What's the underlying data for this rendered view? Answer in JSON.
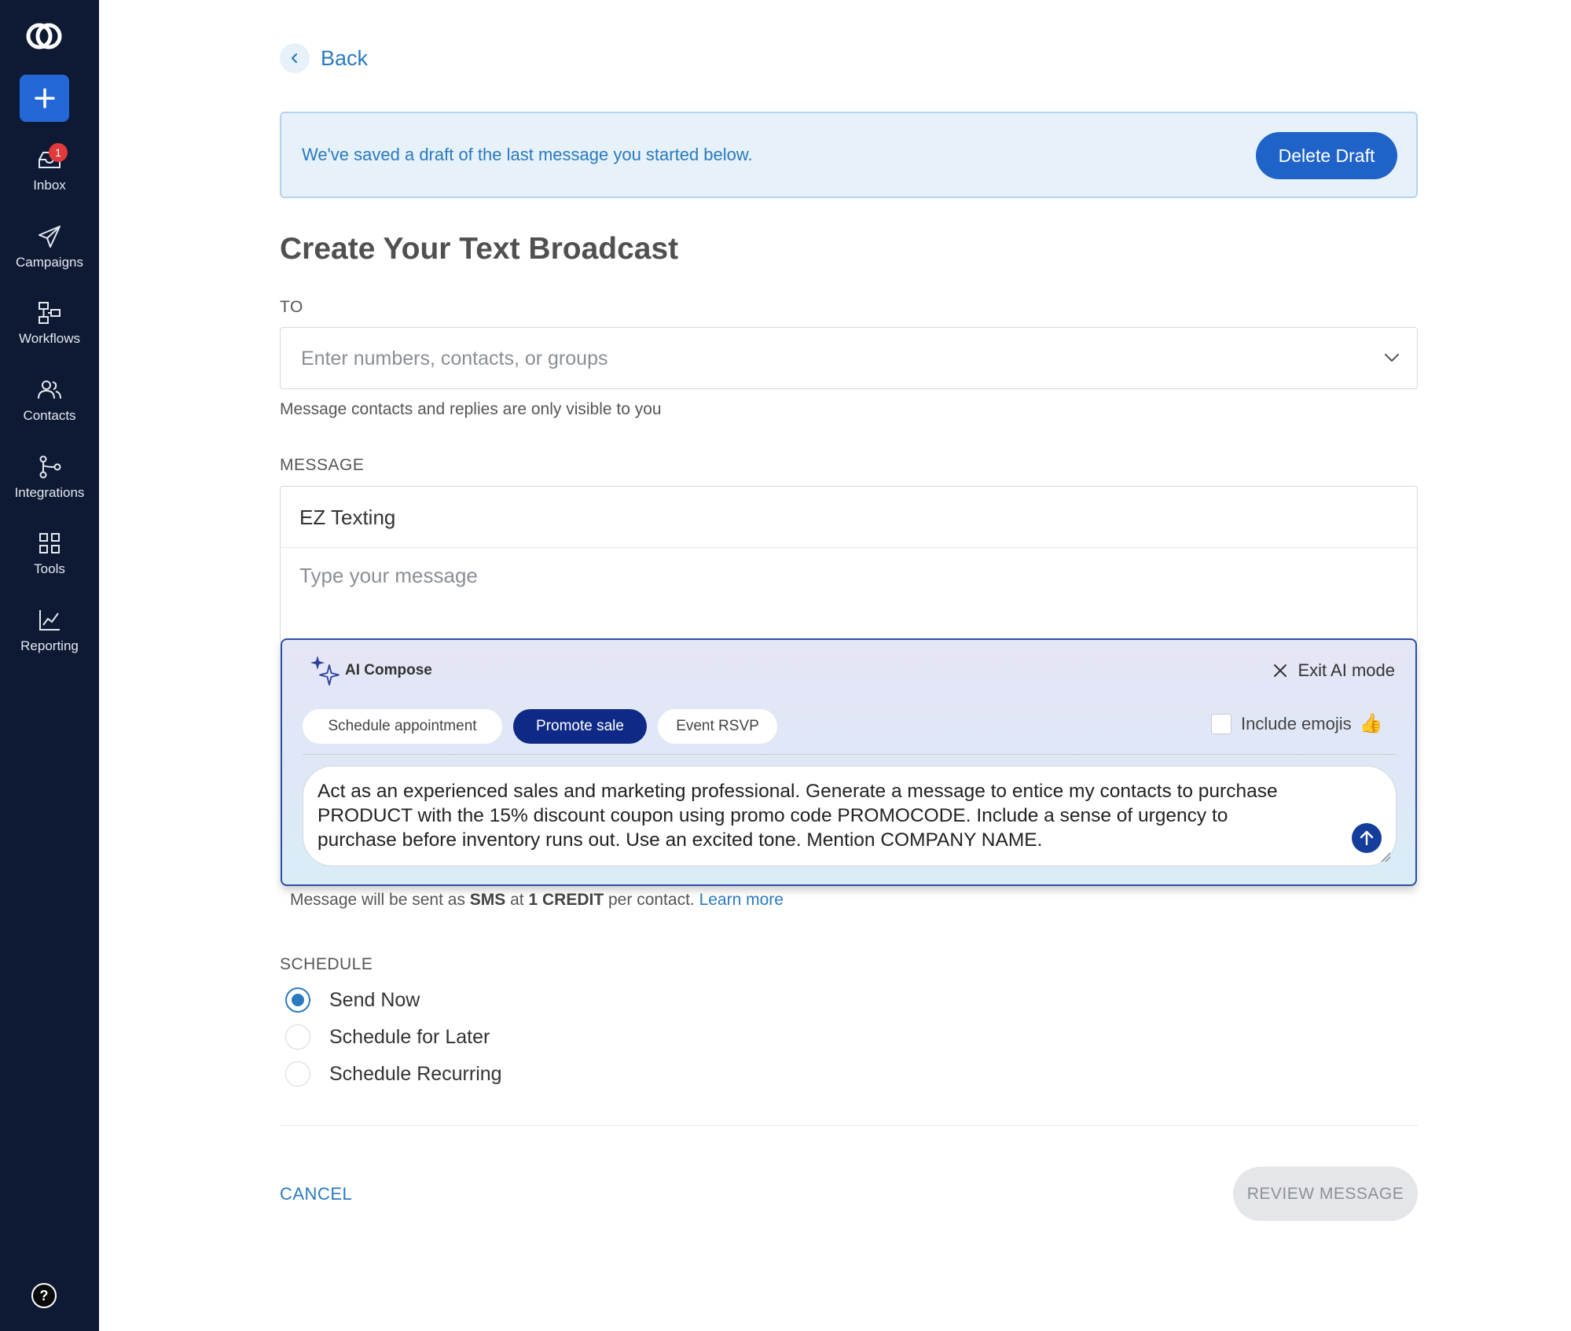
{
  "sidebar": {
    "inbox_badge": "1",
    "items": [
      {
        "label": "Inbox",
        "icon": "inbox-icon"
      },
      {
        "label": "Campaigns",
        "icon": "paper-plane-icon"
      },
      {
        "label": "Workflows",
        "icon": "workflow-icon"
      },
      {
        "label": "Contacts",
        "icon": "contacts-icon"
      },
      {
        "label": "Integrations",
        "icon": "integrations-icon"
      },
      {
        "label": "Tools",
        "icon": "grid-icon"
      },
      {
        "label": "Reporting",
        "icon": "chart-icon"
      }
    ],
    "help_label": "?"
  },
  "back_label": "Back",
  "banner": {
    "text": "We've saved a draft of the last message you started below.",
    "button": "Delete Draft"
  },
  "page_title": "Create Your Text Broadcast",
  "to": {
    "label": "TO",
    "placeholder": "Enter numbers, contacts, or groups",
    "helper": "Message contacts and replies are only visible to you"
  },
  "message": {
    "label": "MESSAGE",
    "sender": "EZ Texting",
    "placeholder": "Type your message"
  },
  "ai_compose": {
    "title": "AI Compose",
    "exit_label": "Exit AI mode",
    "chips": [
      "Schedule appointment",
      "Promote sale",
      "Event RSVP"
    ],
    "active_chip": "Promote sale",
    "include_emojis_label": "Include emojis",
    "include_emojis_checked": false,
    "prompt": "Act as an experienced sales and marketing professional. Generate a message to entice my contacts to purchase PRODUCT with the 15% discount coupon using promo code PROMOCODE. Include a sense of urgency to purchase before inventory runs out. Use an excited tone. Mention COMPANY NAME."
  },
  "sms_note": {
    "part1": "Message will be sent as ",
    "type": "SMS",
    "part2": " at ",
    "credit": "1 CREDIT",
    "part3": " per contact. ",
    "link": "Learn more"
  },
  "schedule": {
    "label": "SCHEDULE",
    "options": [
      "Send Now",
      "Schedule for Later",
      "Schedule Recurring"
    ],
    "selected": "Send Now"
  },
  "footer": {
    "cancel": "CANCEL",
    "review": "REVIEW MESSAGE"
  },
  "colors": {
    "sidebar_bg": "#0e1a33",
    "accent": "#2a7abf",
    "primary_button": "#1f63c9",
    "active_chip": "#0f2a86"
  }
}
